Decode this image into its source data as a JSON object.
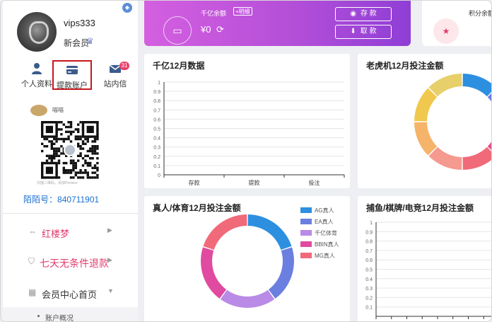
{
  "sidebar": {
    "username": "vips333",
    "level": "新会员",
    "quick_links": [
      {
        "label": "个人资料",
        "icon": "person-icon"
      },
      {
        "label": "提款账户",
        "icon": "card-icon"
      },
      {
        "label": "站内信",
        "icon": "mail-icon",
        "badge": "31"
      }
    ],
    "qr_name": "喵喵",
    "qr_caption": "扫描二维码，添加Pimiens",
    "id_label": "陌陌号：",
    "id_value": "840711901",
    "menu": [
      {
        "label": "红楼梦",
        "icon": "link-icon"
      },
      {
        "label": "七天无条件退款",
        "icon": "shield-icon"
      },
      {
        "label": "会员中心首页",
        "icon": "grid-icon"
      }
    ],
    "subnav_label": "账户概况"
  },
  "balance": {
    "title": "千亿余额",
    "detail_button": "+明细",
    "amount": "¥0",
    "deposit_label": "存 款",
    "withdraw_label": "取 款"
  },
  "points": {
    "label": "积分余额"
  },
  "panels": {
    "p1_title": "千亿12月数据",
    "p2_title": "老虎机12月投注金额",
    "p3_title": "真人/体育12月投注金额",
    "p4_title": "捕鱼/棋牌/电竞12月投注金额"
  },
  "colors": {
    "accent": "#c8161d",
    "brand_gradient_start": "#d45fe0",
    "brand_gradient_end": "#8f3ed6",
    "link_blue": "#1a6fd1",
    "menu_pink": "#e23c6e"
  },
  "chart_data": [
    {
      "type": "bar",
      "title": "千亿12月数据",
      "categories": [
        "存款",
        "提款",
        "投注"
      ],
      "values": [
        0,
        0,
        0
      ],
      "yticks": [
        "1",
        "0.9",
        "0.8",
        "0.7",
        "0.6",
        "0.5",
        "0.4",
        "0.3",
        "0.2",
        "0.1",
        "0"
      ],
      "ylim": [
        0,
        1
      ],
      "grid": true
    },
    {
      "type": "pie",
      "title": "老虎机12月投注金额",
      "values": [
        1,
        1,
        1,
        1,
        1,
        1,
        1,
        1
      ],
      "colors": [
        "#2d8fe0",
        "#6b7fe0",
        "#e24d8a",
        "#f06a7a",
        "#f59a8e",
        "#f6b36a",
        "#f1c84e",
        "#e7cf6a"
      ]
    },
    {
      "type": "pie",
      "title": "真人/体育12月投注金额",
      "legend_position": "top-right",
      "series": [
        {
          "name": "AG真人",
          "value": 1,
          "color": "#2d8fe0"
        },
        {
          "name": "EA真人",
          "value": 1,
          "color": "#6b7fe0"
        },
        {
          "name": "千亿体育",
          "value": 1,
          "color": "#b98ae6"
        },
        {
          "name": "BBIN真人",
          "value": 1,
          "color": "#e04aa0"
        },
        {
          "name": "MG真人",
          "value": 1,
          "color": "#f06a7a"
        }
      ]
    },
    {
      "type": "bar",
      "title": "捕鱼/棋牌/电竞12月投注金额",
      "values": [],
      "yticks": [
        "1",
        "0.9",
        "0.8",
        "0.7",
        "0.6",
        "0.5",
        "0.4",
        "0.3",
        "0.2",
        "0.1"
      ],
      "ylim": [
        0,
        1
      ],
      "grid": true
    }
  ]
}
